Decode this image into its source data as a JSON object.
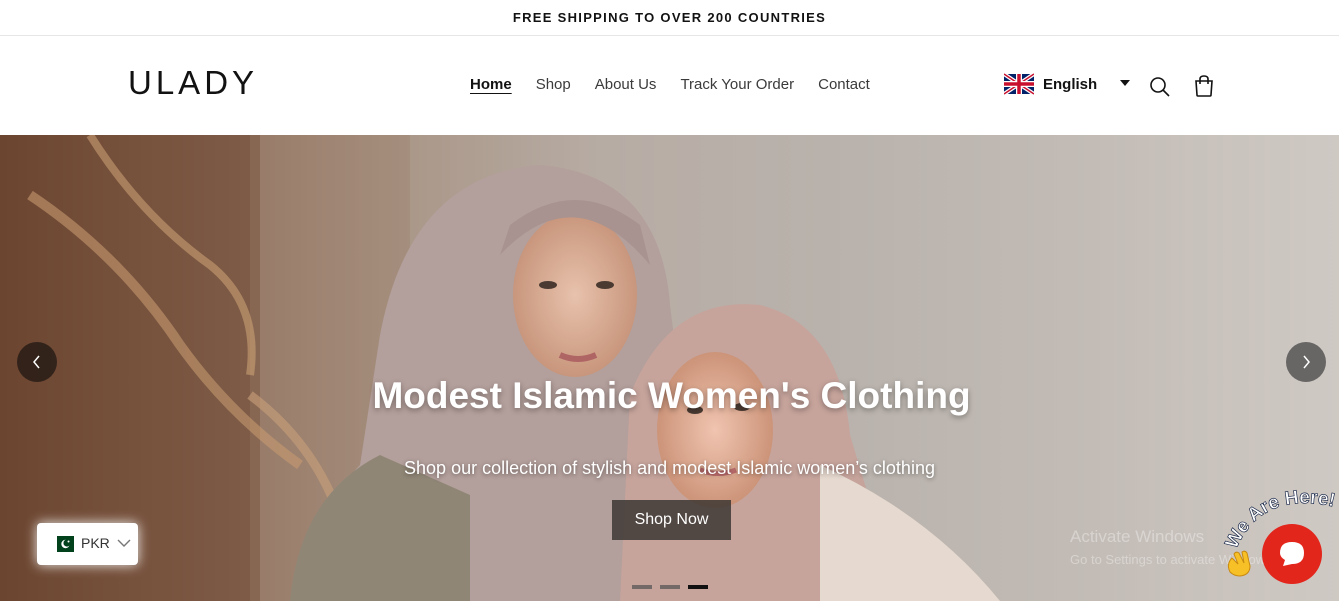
{
  "announcement": {
    "text": "FREE SHIPPING TO OVER 200 COUNTRIES"
  },
  "header": {
    "logo": "ULADY",
    "nav": [
      {
        "label": "Home",
        "active": true
      },
      {
        "label": "Shop"
      },
      {
        "label": "About Us"
      },
      {
        "label": "Track Your Order"
      },
      {
        "label": "Contact"
      }
    ],
    "language": {
      "label": "English",
      "flag": "uk-flag-icon"
    },
    "icons": [
      "search-icon",
      "cart-icon"
    ]
  },
  "hero": {
    "title": "Modest Islamic Women's Clothing",
    "subtitle": "Shop our collection of stylish and modest Islamic women’s clothing",
    "cta": "Shop Now",
    "slides": 3,
    "active_slide": 3
  },
  "currency": {
    "label": "PKR",
    "flag": "pk-flag-icon"
  },
  "watermark": {
    "line1": "Activate Windows",
    "line2": "Go to Settings to activate Windows."
  },
  "chat": {
    "badge_text": "We Are Here!",
    "icon": "chat-icon",
    "wave": "waving-hand-icon"
  },
  "colors": {
    "chat_red": "#e3261c",
    "text_dark": "#121212"
  }
}
